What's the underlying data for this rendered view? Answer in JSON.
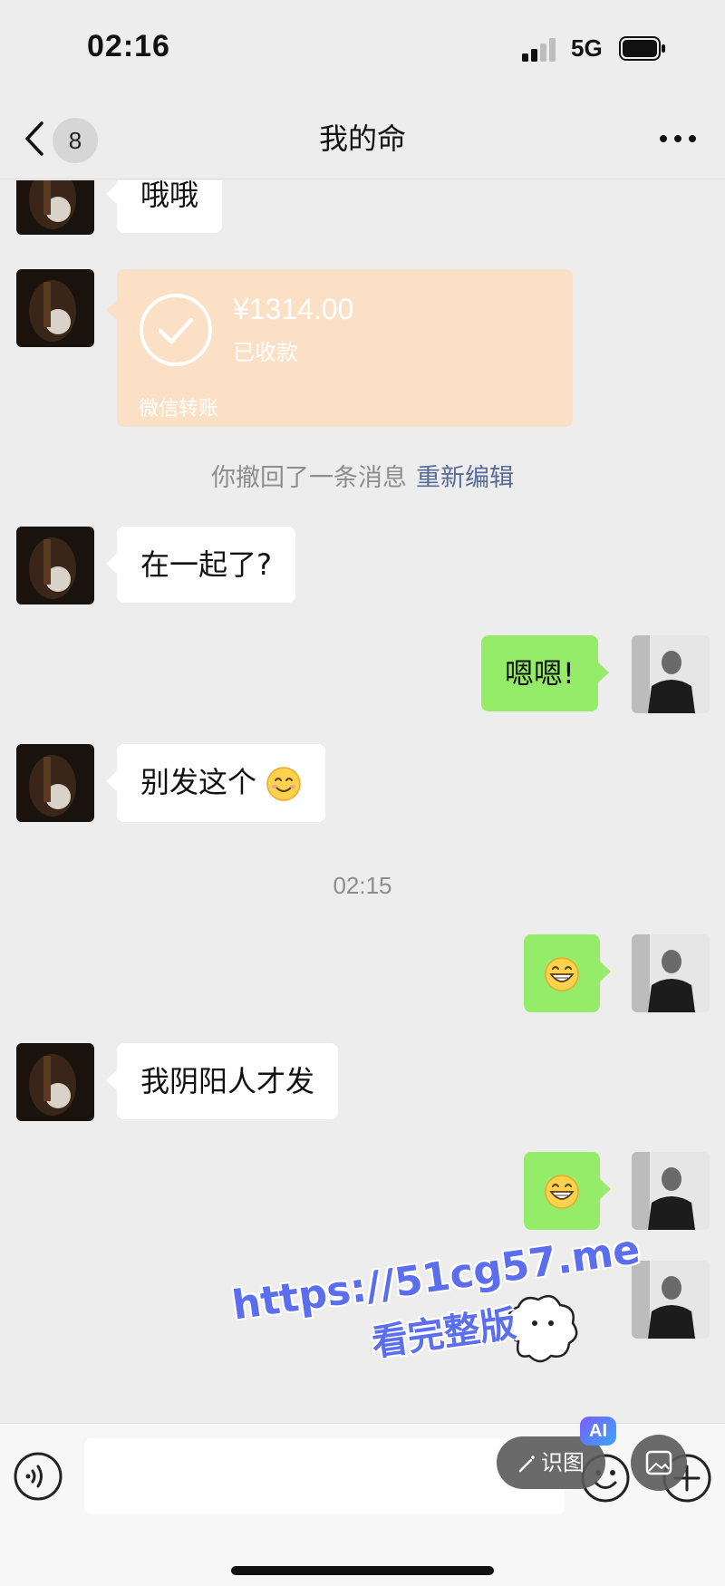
{
  "status_bar": {
    "time": "02:16",
    "network": "5G",
    "icons": [
      "signal-icon",
      "battery-icon"
    ]
  },
  "nav": {
    "unread_count": "8",
    "title": "我的命",
    "icons": [
      "back-icon",
      "more-icon"
    ]
  },
  "messages": {
    "m1": "哦哦",
    "transfer": {
      "amount": "¥1314.00",
      "status": "已收款",
      "label": "微信转账"
    },
    "recall_notice": "你撤回了一条消息",
    "recall_action": "重新编辑",
    "m2": "在一起了?",
    "m3": "嗯嗯!",
    "m4": "别发这个",
    "m4_emoji": "smile-emoji",
    "timestamp": "02:15",
    "m5_emoji": "grin-emoji",
    "m6": "我阴阳人才发",
    "m7_emoji": "grin-emoji"
  },
  "watermark": {
    "url": "https://51cg57.me",
    "text": "看完整版"
  },
  "input_bar": {
    "recognize_label": "识图",
    "ai_badge": "AI",
    "icons": [
      "voice-icon",
      "emoji-icon",
      "plus-icon",
      "photo-icon",
      "magic-wand-icon"
    ]
  },
  "colors": {
    "background": "#ededed",
    "sent_bubble": "#95ec69",
    "received_bubble": "#ffffff",
    "transfer_card": "#fbe0c6",
    "link": "#576b95",
    "watermark": "#5b6ef0"
  }
}
